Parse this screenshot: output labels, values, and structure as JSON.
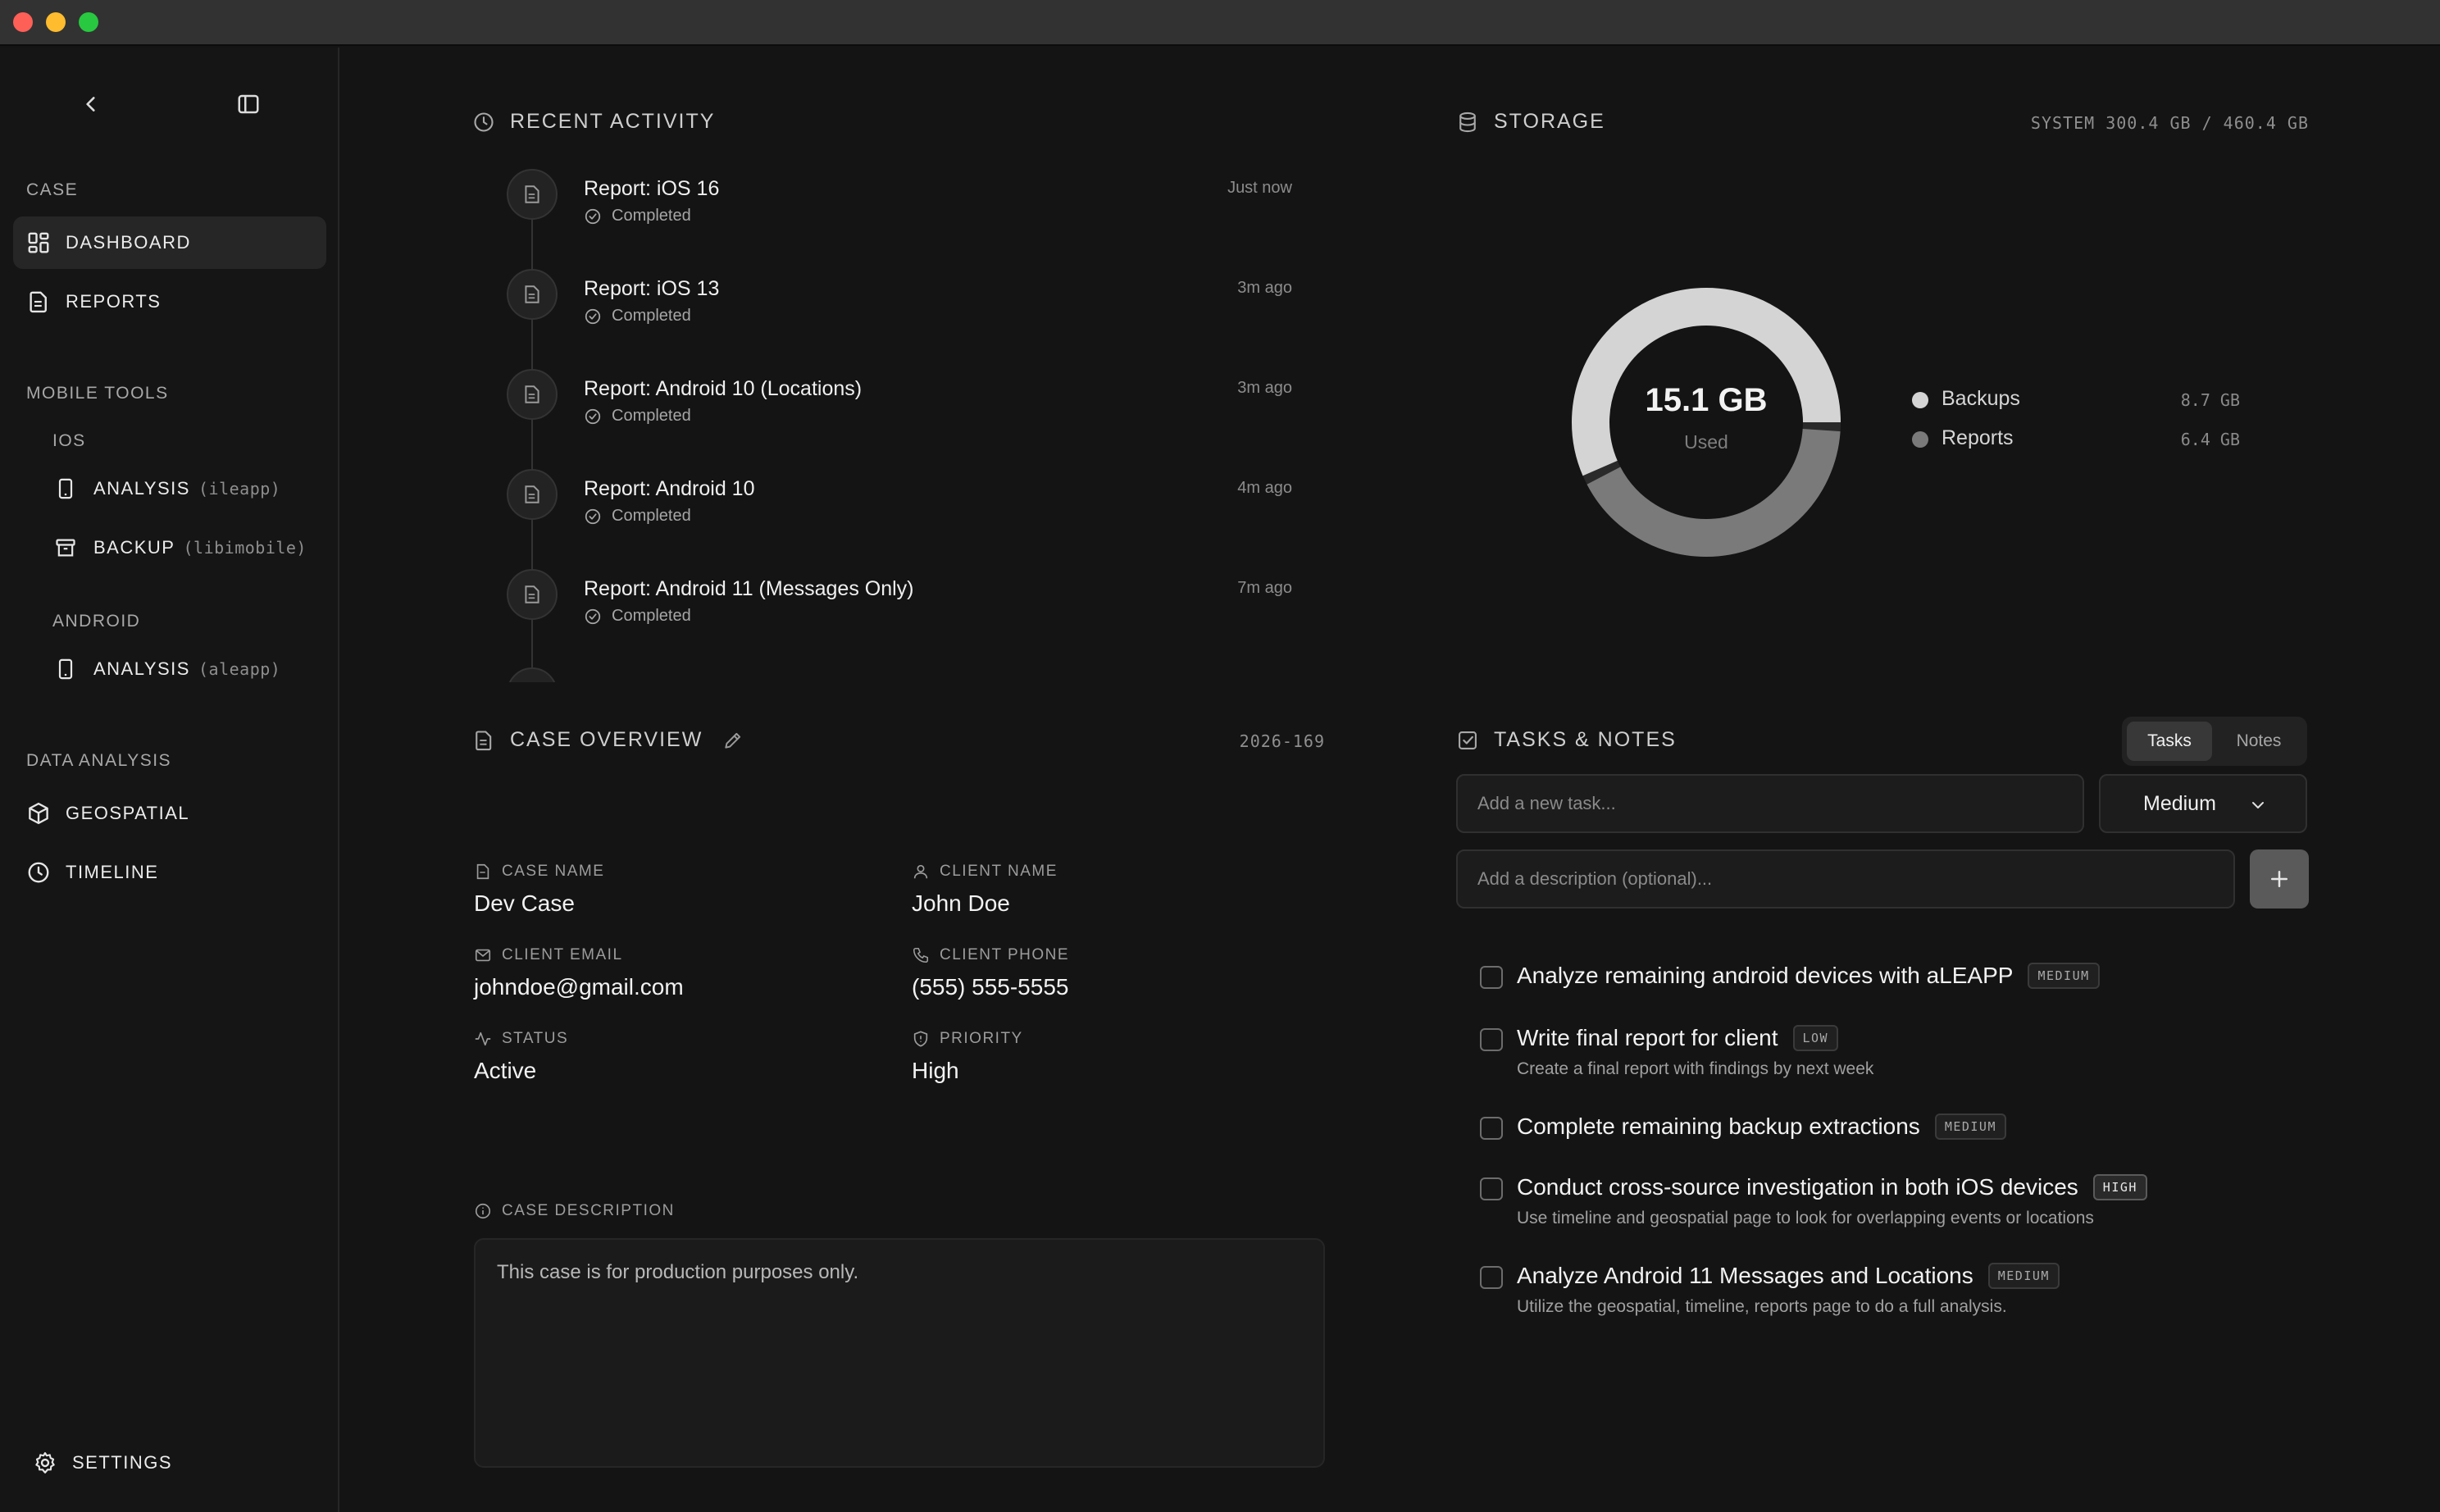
{
  "sidebar": {
    "sections": {
      "case": "CASE",
      "mobile_tools": "MOBILE TOOLS",
      "ios": "IOS",
      "android": "ANDROID",
      "data_analysis": "DATA ANALYSIS"
    },
    "items": {
      "dashboard": "DASHBOARD",
      "reports": "REPORTS",
      "ios_analysis": "ANALYSIS",
      "ios_analysis_sub": "(ileapp)",
      "ios_backup": "BACKUP",
      "ios_backup_sub": "(libimobile)",
      "android_analysis": "ANALYSIS",
      "android_analysis_sub": "(aleapp)",
      "geospatial": "GEOSPATIAL",
      "timeline": "TIMELINE",
      "settings": "SETTINGS"
    }
  },
  "activity": {
    "title": "RECENT ACTIVITY",
    "items": [
      {
        "title": "Report: iOS 16",
        "status": "Completed",
        "time": "Just now"
      },
      {
        "title": "Report: iOS 13",
        "status": "Completed",
        "time": "3m ago"
      },
      {
        "title": "Report: Android 10 (Locations)",
        "status": "Completed",
        "time": "3m ago"
      },
      {
        "title": "Report: Android 10",
        "status": "Completed",
        "time": "4m ago"
      },
      {
        "title": "Report: Android 11 (Messages Only)",
        "status": "Completed",
        "time": "7m ago"
      }
    ]
  },
  "storage": {
    "title": "STORAGE",
    "system": "SYSTEM 300.4 GB / 460.4 GB",
    "used_value": "15.1 GB",
    "used_label": "Used",
    "legend": [
      {
        "label": "Backups",
        "value": "8.7 GB",
        "amount": 8.7,
        "color": "#d4d4d4"
      },
      {
        "label": "Reports",
        "value": "6.4 GB",
        "amount": 6.4,
        "color": "#7a7a7a"
      }
    ]
  },
  "case": {
    "title": "CASE OVERVIEW",
    "id": "2026-169",
    "fields": {
      "case_name_label": "CASE NAME",
      "case_name": "Dev Case",
      "client_name_label": "CLIENT NAME",
      "client_name": "John Doe",
      "client_email_label": "CLIENT EMAIL",
      "client_email": "johndoe@gmail.com",
      "client_phone_label": "CLIENT PHONE",
      "client_phone": "(555) 555-5555",
      "status_label": "STATUS",
      "status": "Active",
      "priority_label": "PRIORITY",
      "priority": "High"
    },
    "description_label": "CASE DESCRIPTION",
    "description": "This case is for production purposes only."
  },
  "tasks": {
    "title": "TASKS & NOTES",
    "tab_tasks": "Tasks",
    "tab_notes": "Notes",
    "task_placeholder": "Add a new task...",
    "desc_placeholder": "Add a description (optional)...",
    "priority_selected": "Medium",
    "items": [
      {
        "title": "Analyze remaining android devices with aLEAPP",
        "badge": "MEDIUM",
        "desc": ""
      },
      {
        "title": "Write final report for client",
        "badge": "LOW",
        "desc": "Create a final report with findings by next week"
      },
      {
        "title": "Complete remaining backup extractions",
        "badge": "MEDIUM",
        "desc": ""
      },
      {
        "title": "Conduct cross-source investigation in both iOS devices",
        "badge": "HIGH",
        "desc": "Use timeline and geospatial page to look for overlapping events or locations"
      },
      {
        "title": "Analyze Android 11 Messages and Locations",
        "badge": "MEDIUM",
        "desc": "Utilize the geospatial, timeline, reports page to do a full analysis."
      }
    ]
  }
}
